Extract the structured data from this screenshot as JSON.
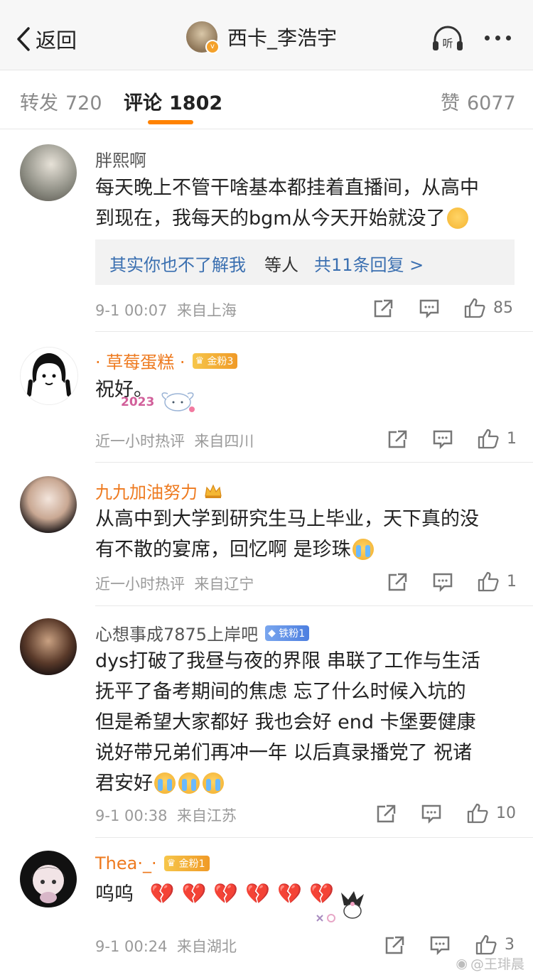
{
  "nav": {
    "back_label": "返回",
    "user_name": "西卡_李浩宇",
    "listen_label": "听"
  },
  "tabs": [
    {
      "label": "转发",
      "count": "720"
    },
    {
      "label": "评论",
      "count": "1802"
    },
    {
      "label": "赞",
      "count": "6077"
    }
  ],
  "comments": [
    {
      "name": "胖熙啊",
      "text1": "每天晚上不管干啥基本都挂着直播间，从高中",
      "text2": "到现在，我每天的bgm从今天开始就没了",
      "reply_author": "其实你也不了解我",
      "reply_mid": "等人",
      "reply_count": "共11条回复 >",
      "time": "9-1 00:07",
      "location": "来自上海",
      "likes": "85"
    },
    {
      "name": "· 草莓蛋糕 ·",
      "badge": "金粉3",
      "text1": "祝好。",
      "sticker": "2023",
      "time": "近一小时热评",
      "location": "来自四川",
      "likes": "1"
    },
    {
      "name": "九九加油努力",
      "text1": "从高中到大学到研究生马上毕业，天下真的没",
      "text2": "有不散的宴席，回忆啊 是珍珠",
      "time": "近一小时热评",
      "location": "来自辽宁",
      "likes": "1"
    },
    {
      "name": "心想事成7875上岸吧",
      "badge": "铁粉1",
      "text1": "dys打破了我昼与夜的界限 串联了工作与生活",
      "text2": "抚平了备考期间的焦虑 忘了什么时候入坑的",
      "text3": "但是希望大家都好  我也会好 end  卡堡要健康",
      "text4": "说好带兄弟们再冲一年 以后真录播党了  祝诸",
      "text5": "君安好",
      "time": "9-1 00:38",
      "location": "来自江苏",
      "likes": "10"
    },
    {
      "name": "Thea·_·",
      "badge": "金粉1",
      "text1": "呜呜",
      "time": "9-1 00:24",
      "location": "来自湖北",
      "likes": "3"
    }
  ],
  "watermark": "@王琲晨",
  "colors": {
    "accent": "#ff8200",
    "link": "#3a6fb0",
    "orange_name": "#ee7a1f",
    "heart": "#e1263a"
  }
}
